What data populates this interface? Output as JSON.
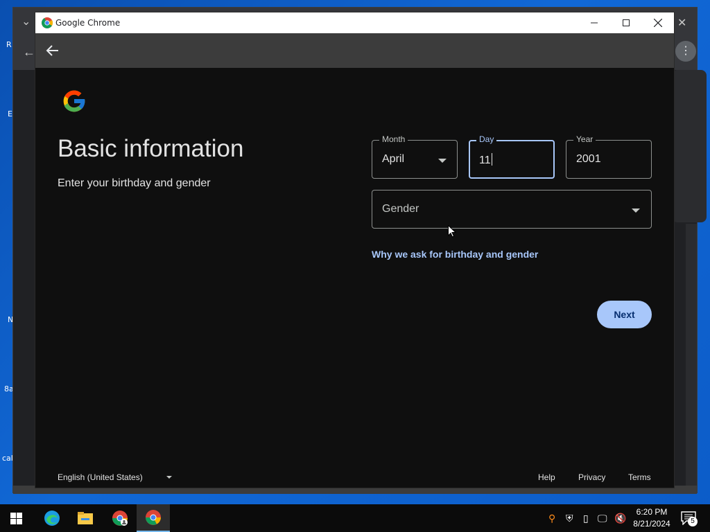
{
  "window": {
    "title": "Google Chrome"
  },
  "form": {
    "title": "Basic information",
    "subtitle": "Enter your birthday and gender",
    "month": {
      "label": "Month",
      "value": "April"
    },
    "day": {
      "label": "Day",
      "value": "11"
    },
    "year": {
      "label": "Year",
      "value": "2001"
    },
    "gender": {
      "placeholder": "Gender"
    },
    "why_link": "Why we ask for birthday and gender",
    "next_label": "Next"
  },
  "footer": {
    "language": "English (United States)",
    "help": "Help",
    "privacy": "Privacy",
    "terms": "Terms"
  },
  "taskbar": {
    "time": "6:20 PM",
    "date": "8/21/2024",
    "notification_count": "5"
  },
  "colors": {
    "accent": "#a8c7fa",
    "page_bg": "#0f0f0f",
    "button_text": "#062e6f"
  },
  "icons": {
    "logo": "google-g-icon",
    "back": "back-arrow-icon",
    "dropdown": "dropdown-arrow-icon"
  }
}
